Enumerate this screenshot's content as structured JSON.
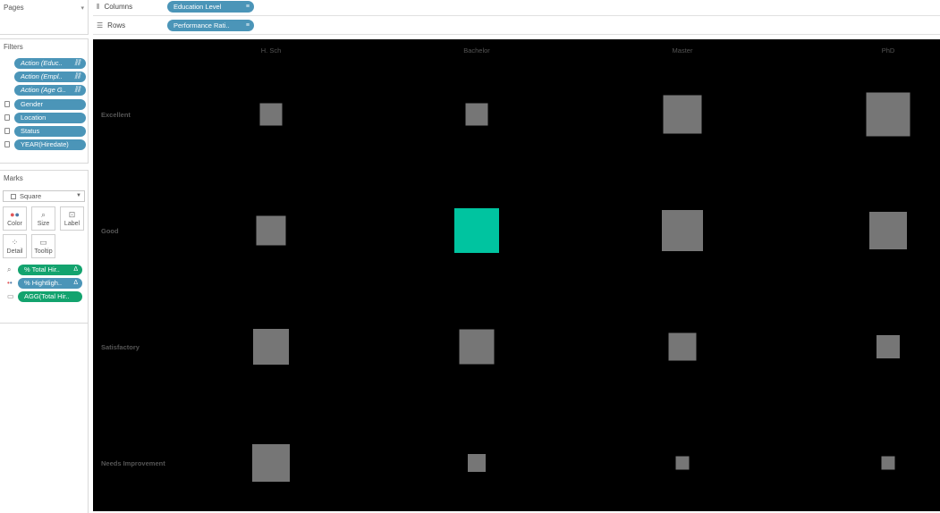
{
  "pages_panel": {
    "title": "Pages"
  },
  "filters_panel": {
    "title": "Filters",
    "items": [
      {
        "label": "Action (Educ..",
        "italic": true,
        "locked": false
      },
      {
        "label": "Action (Empl..",
        "italic": true,
        "locked": false
      },
      {
        "label": "Action (Age G..",
        "italic": true,
        "locked": false
      },
      {
        "label": "Gender",
        "italic": false,
        "locked": true
      },
      {
        "label": "Location",
        "italic": false,
        "locked": true
      },
      {
        "label": "Status",
        "italic": false,
        "locked": true
      },
      {
        "label": "YEAR(Hiredate)",
        "italic": false,
        "locked": true
      }
    ]
  },
  "marks_panel": {
    "title": "Marks",
    "mark_type": "Square",
    "buttons": [
      "Color",
      "Size",
      "Label",
      "Detail",
      "Tooltip"
    ],
    "fields": [
      {
        "label": "% Total Hir..",
        "color": "green",
        "shelf_icon": "size-icon"
      },
      {
        "label": "% Hightligh..",
        "color": "blue",
        "shelf_icon": "color-icon"
      },
      {
        "label": "AGG(Total Hir..",
        "color": "green",
        "shelf_icon": "tooltip-icon"
      }
    ]
  },
  "columns_shelf": {
    "label": "Columns",
    "pill": "Education Level"
  },
  "rows_shelf": {
    "label": "Rows",
    "pill": "Performance Rati.."
  },
  "colors": {
    "background": "#000000",
    "default_mark": "#767676",
    "highlight_mark": "#00c4a0",
    "header_text": "#555555"
  },
  "chart_data": {
    "type": "heatmap",
    "mark": "square",
    "columns": [
      "H. Sch",
      "Bachelor",
      "Master",
      "PhD"
    ],
    "rows": [
      "Excellent",
      "Good",
      "Satisfactory",
      "Needs Improvement"
    ],
    "size_field": "% Total Hir..",
    "color_field": "% Hightligh..",
    "relative_size": [
      [
        25,
        25,
        43,
        49
      ],
      [
        33,
        50,
        46,
        42
      ],
      [
        40,
        39,
        31,
        26
      ],
      [
        42,
        20,
        15,
        15
      ]
    ],
    "highlighted": [
      [
        false,
        false,
        false,
        false
      ],
      [
        false,
        true,
        false,
        false
      ],
      [
        false,
        false,
        false,
        false
      ],
      [
        false,
        false,
        false,
        false
      ]
    ]
  }
}
